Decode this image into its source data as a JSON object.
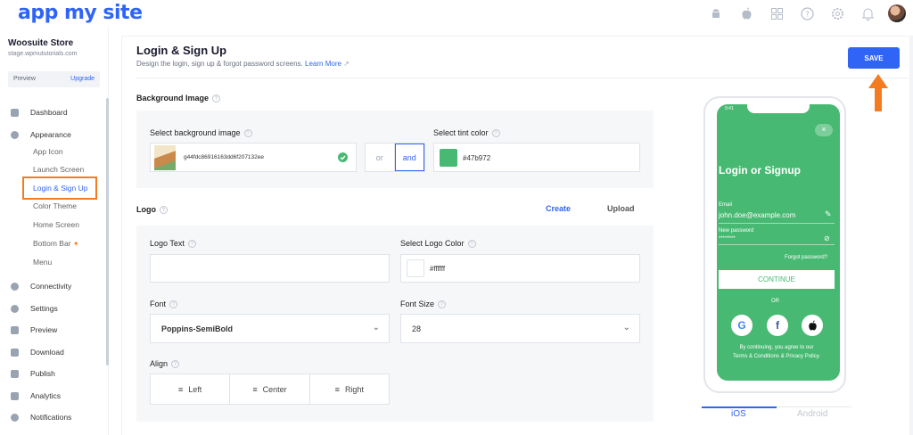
{
  "app": {
    "logo": "app my site"
  },
  "topbar": {
    "icons": [
      "android-icon",
      "apple-icon",
      "grid-icon",
      "help-icon",
      "gear-icon",
      "bell-icon"
    ]
  },
  "sidebar": {
    "store_name": "Woosuite Store",
    "store_url": "stage.wpmututorials.com",
    "preview_label": "Preview",
    "upgrade_label": "Upgrade",
    "items": {
      "dashboard": "Dashboard",
      "appearance": "Appearance",
      "app_icon": "App Icon",
      "launch_screen": "Launch Screen",
      "login_signup": "Login & Sign Up",
      "color_theme": "Color Theme",
      "home_screen": "Home Screen",
      "bottom_bar": "Bottom Bar",
      "menu": "Menu",
      "connectivity": "Connectivity",
      "settings": "Settings",
      "preview": "Preview",
      "download": "Download",
      "publish": "Publish",
      "analytics": "Analytics",
      "notifications": "Notifications"
    }
  },
  "header": {
    "title": "Login & Sign Up",
    "subtitle": "Design the login, sign up & forgot password screens.",
    "learn_more": "Learn More",
    "save_label": "SAVE"
  },
  "background": {
    "section_label": "Background Image",
    "select_image_label": "Select background image",
    "image_filename": "g44fdc86916163dd6f207132ee",
    "or_label": "or",
    "and_label": "and",
    "tint_label": "Select tint color",
    "tint_value": "#47b972"
  },
  "logo": {
    "section_label": "Logo",
    "create_label": "Create",
    "upload_label": "Upload",
    "logo_text_label": "Logo Text",
    "logo_text_value": "",
    "logo_color_label": "Select Logo Color",
    "logo_color_value": "#ffffff",
    "font_label": "Font",
    "font_value": "Poppins-SemiBold",
    "font_size_label": "Font Size",
    "font_size_value": "28",
    "align_label": "Align",
    "align_options": [
      "Left",
      "Center",
      "Right"
    ]
  },
  "preview": {
    "time": "9:41",
    "close": "×",
    "heading": "Login or Signup",
    "email_label": "Email",
    "email_value": "john.doe@example.com",
    "password_label": "New password",
    "password_value": "********",
    "forgot": "Forgot password?",
    "continue": "CONTINUE",
    "or": "OR",
    "terms_line1": "By continuing, you agree to our",
    "terms_line2": "Terms & Conditions & Privacy Policy.",
    "tab_ios": "iOS",
    "tab_android": "Android"
  },
  "colors": {
    "accent": "#3064f6",
    "tint": "#47b972",
    "highlight": "#f47c20"
  }
}
